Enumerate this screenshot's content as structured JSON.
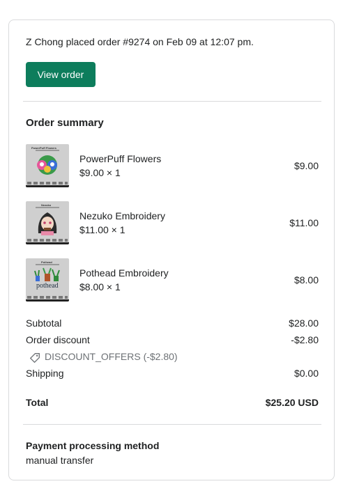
{
  "notice": "Z Chong placed order #9274 on Feb 09 at 12:07 pm.",
  "view_order_label": "View order",
  "summary_title": "Order summary",
  "items": [
    {
      "name": "PowerPuff Flowers",
      "qty": "$9.00 × 1",
      "total": "$9.00",
      "thumb_title": "PowerPuff Flowers"
    },
    {
      "name": "Nezuko Embroidery",
      "qty": "$11.00 × 1",
      "total": "$11.00",
      "thumb_title": "Nezuko"
    },
    {
      "name": "Pothead Embroidery",
      "qty": "$8.00 × 1",
      "total": "$8.00",
      "thumb_title": "Pothead",
      "thumb_text": "pothead"
    }
  ],
  "subtotal": {
    "label": "Subtotal",
    "value": "$28.00"
  },
  "discount": {
    "label": "Order discount",
    "value": "-$2.80",
    "code": "DISCOUNT_OFFERS (-$2.80)"
  },
  "shipping": {
    "label": "Shipping",
    "value": "$0.00"
  },
  "total": {
    "label": "Total",
    "value": "$25.20 USD"
  },
  "payment": {
    "title": "Payment processing method",
    "value": "manual transfer"
  },
  "colors": {
    "button": "#0d7d5c",
    "divider": "#d9dadc",
    "muted": "#6d7175"
  }
}
